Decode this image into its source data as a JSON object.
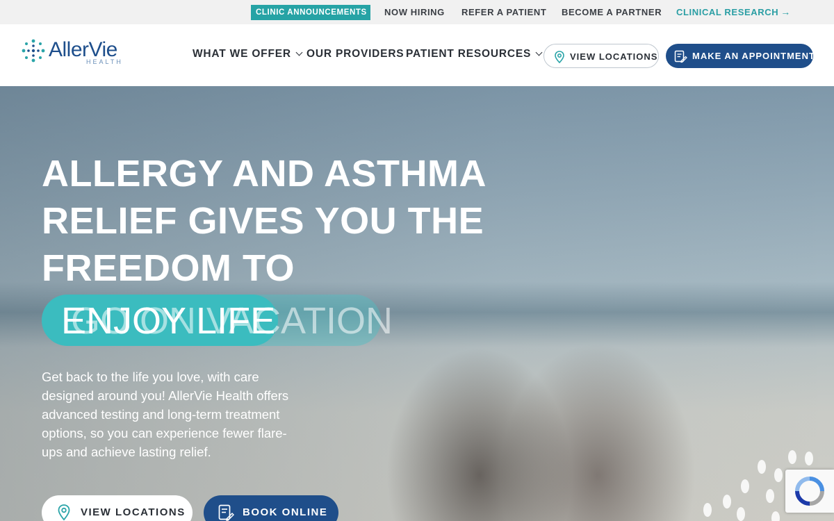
{
  "utility_nav": {
    "announcements": "CLINIC ANNOUNCEMENTS",
    "hiring": "NOW HIRING",
    "refer": "REFER A PATIENT",
    "partner": "BECOME A PARTNER",
    "research": "CLINICAL RESEARCH"
  },
  "brand": {
    "name": "AllerVie",
    "tagline": "HEALTH"
  },
  "main_nav": {
    "offer": "WHAT WE OFFER",
    "providers": "OUR PROVIDERS",
    "resources": "PATIENT RESOURCES",
    "locations_btn": "VIEW LOCATIONS",
    "appointment_btn": "MAKE AN APPOINTMENT"
  },
  "hero": {
    "title_lines": [
      "ALLERGY AND ASTHMA",
      "RELIEF GIVES YOU THE",
      "FREEDOM TO"
    ],
    "word_active": "ENJOY LIFE",
    "word_fading": "GO ON VACATION",
    "body": "Get back to the life you love, with care designed around you! AllerVie Health offers advanced testing and long-term treatment options, so you can experience fewer flare-ups and achieve lasting relief.",
    "btn_locations": "VIEW LOCATIONS",
    "btn_book": "BOOK ONLINE"
  },
  "colors": {
    "teal": "#26a3a5",
    "navy": "#1f4e8a",
    "pill": "#3bbcbf"
  }
}
